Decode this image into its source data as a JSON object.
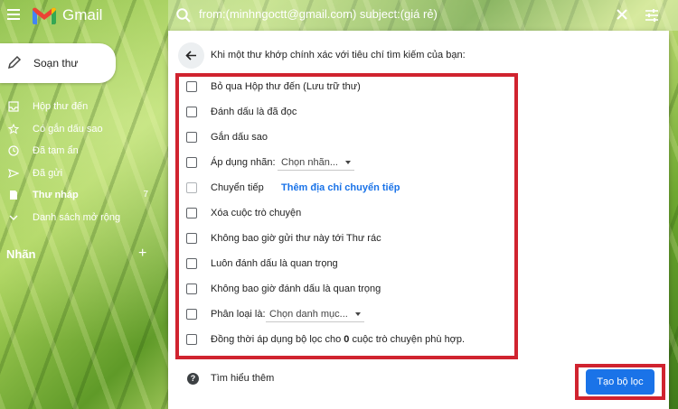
{
  "app": {
    "name": "Gmail"
  },
  "search": {
    "query": "from:(minhngoctt@gmail.com) subject:(giá rẻ)"
  },
  "compose": {
    "label": "Soạn thư"
  },
  "sidebar": {
    "items": [
      {
        "label": "Hộp thư đến",
        "icon": "inbox-icon",
        "count": ""
      },
      {
        "label": "Có gắn dấu sao",
        "icon": "star-icon",
        "count": ""
      },
      {
        "label": "Đã tạm ẩn",
        "icon": "clock-icon",
        "count": ""
      },
      {
        "label": "Đã gửi",
        "icon": "send-icon",
        "count": ""
      },
      {
        "label": "Thư nháp",
        "icon": "draft-icon",
        "count": "7"
      },
      {
        "label": "Danh sách mở rộng",
        "icon": "chevron-down-icon",
        "count": ""
      }
    ],
    "labels_title": "Nhãn",
    "labels_add": "+"
  },
  "filter": {
    "header": "Khi một thư khớp chính xác với tiêu chí tìm kiếm của bạn:",
    "options": [
      {
        "label": "Bỏ qua Hộp thư đến (Lưu trữ thư)"
      },
      {
        "label": "Đánh dấu là đã đọc"
      },
      {
        "label": "Gắn dấu sao"
      },
      {
        "label": "Áp dụng nhãn:",
        "dropdown": "Chọn nhãn..."
      },
      {
        "label": "Chuyển tiếp",
        "link": "Thêm địa chỉ chuyển tiếp",
        "disabled": true
      },
      {
        "label": "Xóa cuộc trò chuyện"
      },
      {
        "label": "Không bao giờ gửi thư này tới Thư rác"
      },
      {
        "label": "Luôn đánh dấu là quan trọng"
      },
      {
        "label": "Không bao giờ đánh dấu là quan trọng"
      },
      {
        "label": "Phân loại là:",
        "dropdown": "Chọn danh mục..."
      },
      {
        "label_prefix": "Đồng thời áp dụng bộ lọc cho ",
        "count": "0",
        "label_suffix": " cuộc trò chuyện phù hợp."
      }
    ],
    "help_icon": "?",
    "help_link": "Tìm hiểu thêm",
    "create_button": "Tạo bộ lọc"
  },
  "colors": {
    "accent": "#1a73e8",
    "highlight": "#d0232f"
  }
}
